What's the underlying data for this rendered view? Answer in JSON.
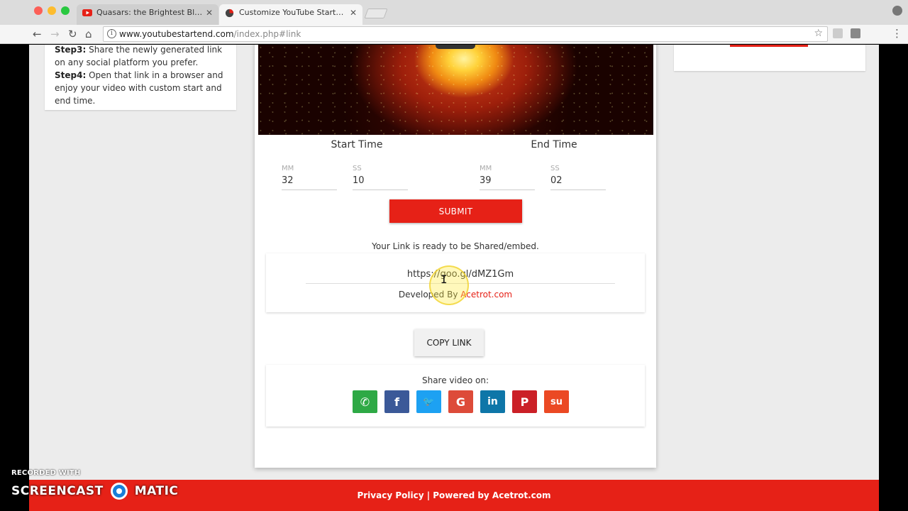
{
  "browser": {
    "tabs": [
      {
        "title": "Quasars: the Brightest Black H",
        "favicon": "youtube-icon",
        "active": false
      },
      {
        "title": "Customize YouTube Start and E",
        "favicon": "site-icon",
        "active": true
      }
    ],
    "close_glyph": "✕",
    "address": {
      "host": "www.youtubestartend.com",
      "path": "/index.php#link"
    }
  },
  "instructions": {
    "step3_label": "Step3:",
    "step3_text": " Share the newly generated link on any social platform you prefer.",
    "step4_label": "Step4:",
    "step4_text": " Open that link in a browser and enjoy your video with custom start and end time."
  },
  "form": {
    "start_heading": "Start Time",
    "end_heading": "End Time",
    "mm_label": "MM",
    "ss_label": "SS",
    "start_mm": "32",
    "start_ss": "10",
    "end_mm": "39",
    "end_ss": "02",
    "submit_label": "SUBMIT"
  },
  "result": {
    "ready_text": "Your Link is ready to be Shared/embed.",
    "short_link": "https://goo.gl/dMZ1Gm",
    "developed_by": "Developed By ",
    "developer": "Acetrot.com",
    "copy_label": "COPY LINK"
  },
  "share": {
    "label": "Share video on:",
    "buttons": [
      {
        "name": "whatsapp",
        "glyph": "✆",
        "color": "#2ea945"
      },
      {
        "name": "facebook",
        "glyph": "f",
        "color": "#3b5998"
      },
      {
        "name": "twitter",
        "glyph": "🐦",
        "color": "#1da1f2"
      },
      {
        "name": "google-plus",
        "glyph": "G",
        "color": "#dd4b39"
      },
      {
        "name": "linkedin",
        "glyph": "in",
        "color": "#0e76a8"
      },
      {
        "name": "pinterest",
        "glyph": "P",
        "color": "#cb2027"
      },
      {
        "name": "stumbleupon",
        "glyph": "su",
        "color": "#eb4924"
      }
    ]
  },
  "footer": {
    "text": "Privacy Policy | Powered by Acetrot.com"
  },
  "watermark": {
    "top": "RECORDED WITH",
    "left": "SCREENCAST",
    "right": "MATIC"
  },
  "colors": {
    "brand_red": "#e62117"
  }
}
